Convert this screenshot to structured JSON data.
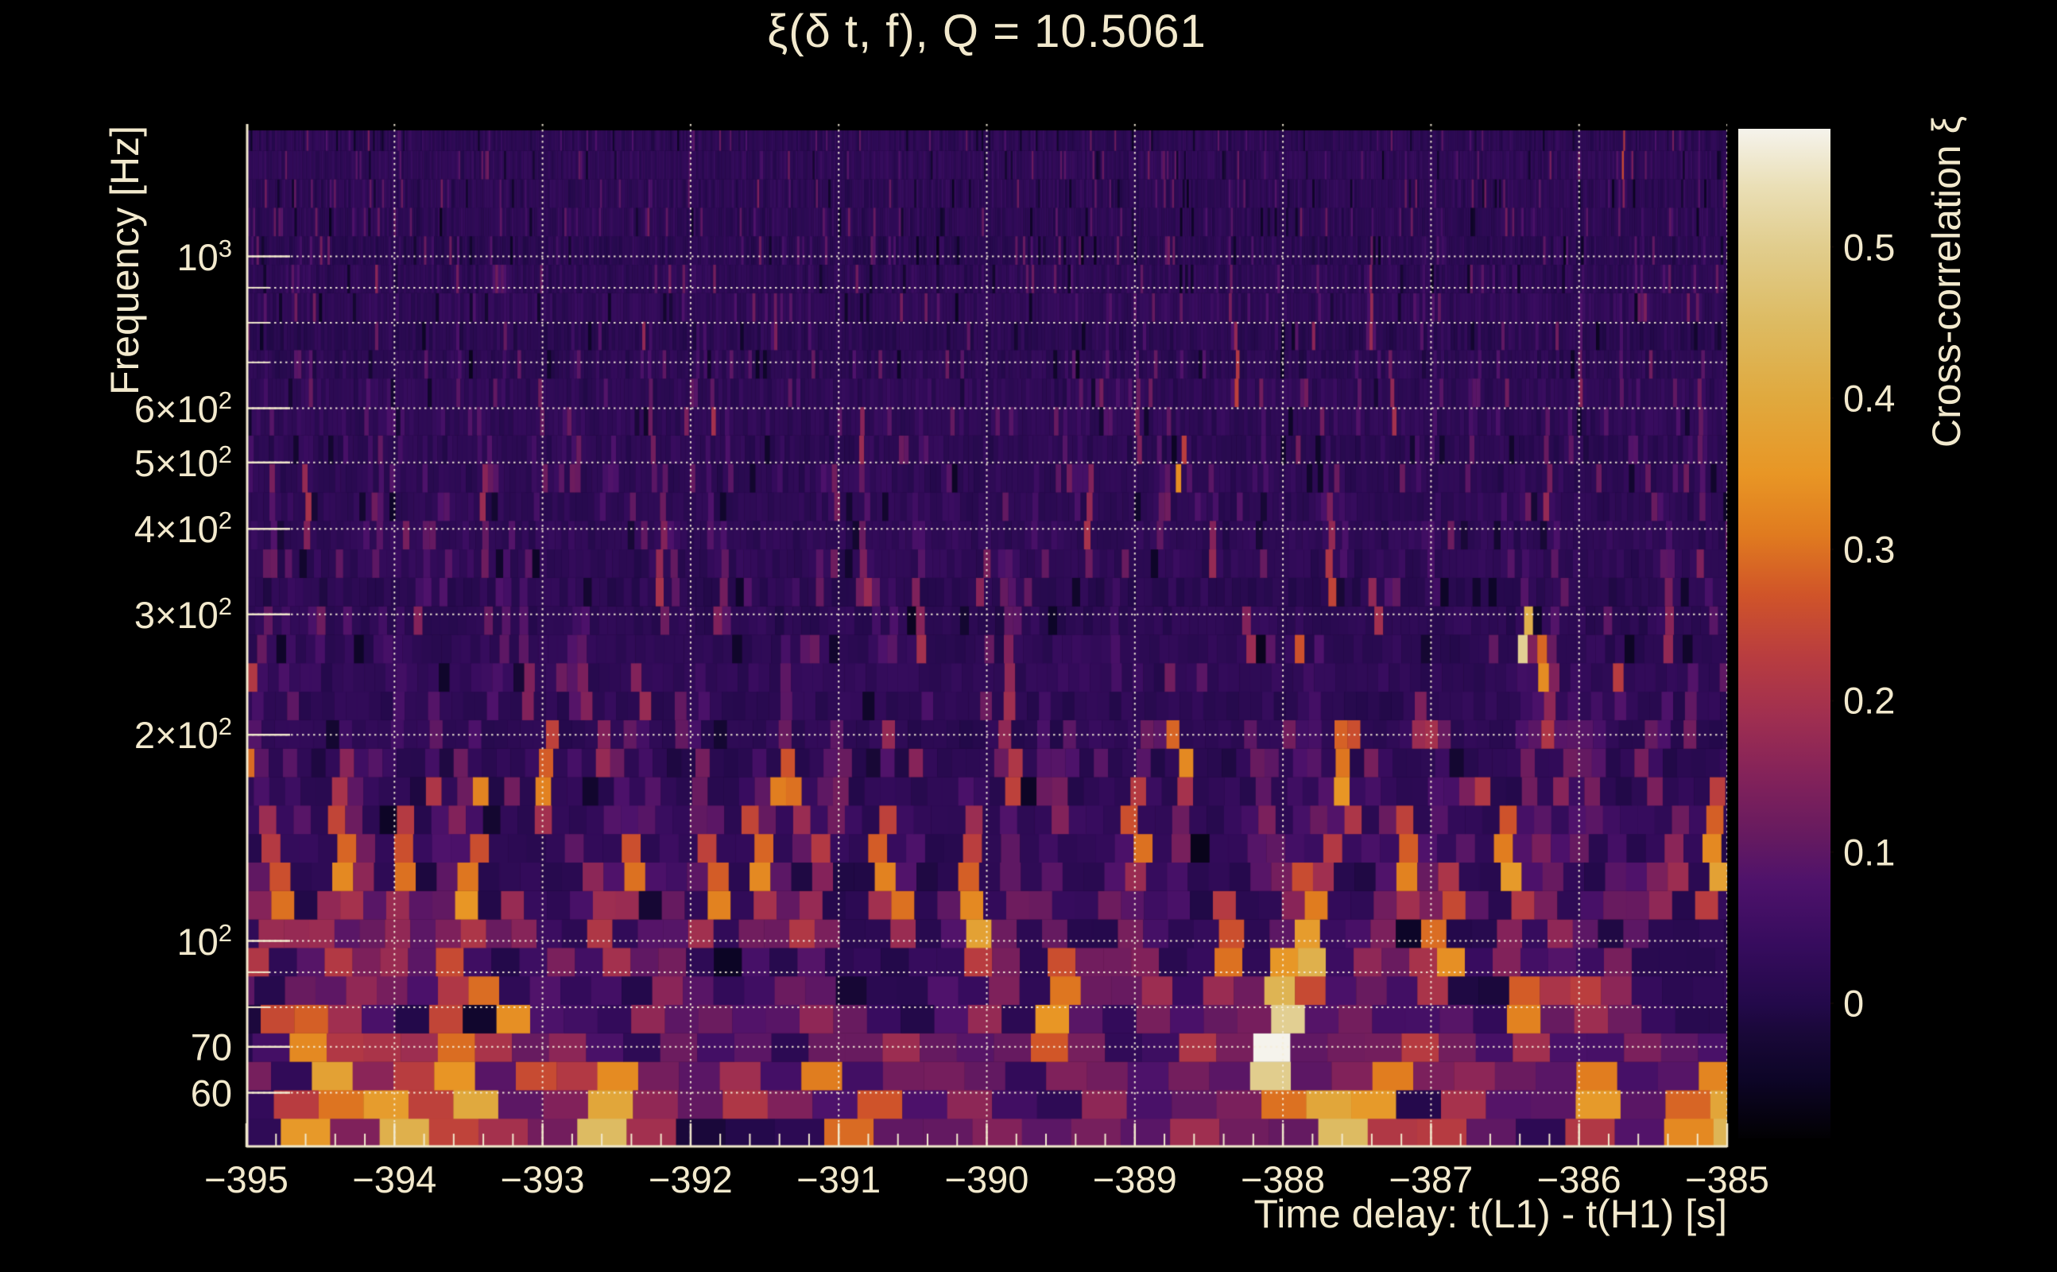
{
  "page": {
    "background": "#000000",
    "text_color": "#f2e9cd"
  },
  "chart_data": {
    "type": "heatmap",
    "title": "ξ(δ t, f), Q = 10.5061",
    "q_value": "10.5061",
    "xlabel": "Time delay: t(L1) - t(H1) [s]",
    "ylabel": "Frequency [Hz]",
    "colorbar_label": "Cross-correlation ξ",
    "x_range": [
      -395,
      -385
    ],
    "x_tick_labels": [
      "−395",
      "−394",
      "−393",
      "−392",
      "−391",
      "−390",
      "−389",
      "−388",
      "−387",
      "−386",
      "−385"
    ],
    "x_tick_values": [
      -395,
      -394,
      -393,
      -392,
      -391,
      -390,
      -389,
      -388,
      -387,
      -386,
      -385
    ],
    "x_minor_step": 0.2,
    "y_scale": "log",
    "y_range": [
      50,
      1560
    ],
    "y_tick_labels": [
      {
        "main": "10",
        "sup": "3",
        "f": 1000
      },
      {
        "main": "6×10",
        "sup": "2",
        "f": 600
      },
      {
        "main": "5×10",
        "sup": "2",
        "f": 500
      },
      {
        "main": "4×10",
        "sup": "2",
        "f": 400
      },
      {
        "main": "3×10",
        "sup": "2",
        "f": 300
      },
      {
        "main": "2×10",
        "sup": "2",
        "f": 200
      },
      {
        "main": "10",
        "sup": "2",
        "f": 100
      },
      {
        "main": "70",
        "sup": "",
        "f": 70
      },
      {
        "main": "60",
        "sup": "",
        "f": 60
      }
    ],
    "y_minor_ticks": [
      900,
      800,
      700,
      90,
      80
    ],
    "y_gridlines": [
      1000,
      900,
      800,
      700,
      600,
      500,
      400,
      300,
      200,
      100,
      90,
      80,
      70,
      60
    ],
    "grid": "dotted",
    "legend_position": "right-colorbar",
    "colorbar": {
      "min": -0.089,
      "max": 0.578,
      "tick_values": [
        0.5,
        0.4,
        0.3,
        0.2,
        0.1,
        0
      ],
      "tick_labels": [
        "0.5",
        "0.4",
        "0.3",
        "0.2",
        "0.1",
        "0"
      ],
      "stops": [
        {
          "v": -0.089,
          "c": "#020103"
        },
        {
          "v": -0.05,
          "c": "#0d0527"
        },
        {
          "v": -0.02,
          "c": "#190838"
        },
        {
          "v": 0.0,
          "c": "#23094a"
        },
        {
          "v": 0.04,
          "c": "#370c5e"
        },
        {
          "v": 0.08,
          "c": "#4e126b"
        },
        {
          "v": 0.11,
          "c": "#651a60"
        },
        {
          "v": 0.15,
          "c": "#83225a"
        },
        {
          "v": 0.19,
          "c": "#a02f50"
        },
        {
          "v": 0.23,
          "c": "#b93d3f"
        },
        {
          "v": 0.27,
          "c": "#d05429"
        },
        {
          "v": 0.31,
          "c": "#e07b1f"
        },
        {
          "v": 0.35,
          "c": "#e89625"
        },
        {
          "v": 0.4,
          "c": "#e0a93e"
        },
        {
          "v": 0.45,
          "c": "#ddbb62"
        },
        {
          "v": 0.5,
          "c": "#e1cd8d"
        },
        {
          "v": 0.54,
          "c": "#eadfb6"
        },
        {
          "v": 0.578,
          "c": "#f5f3ec"
        }
      ]
    },
    "heatmap": {
      "f0": 50,
      "rows": 36,
      "row_ratio": 1.1005,
      "tile_duration_factor": 17.5,
      "seed": 1337,
      "noise_events": 540,
      "hotspots": [
        [
          -394.83,
          110,
          0.3,
          4
        ],
        [
          -394.55,
          62,
          0.38,
          3
        ],
        [
          -394.35,
          120,
          0.33,
          5
        ],
        [
          -394.0,
          52,
          0.42,
          2
        ],
        [
          -393.96,
          130,
          0.3,
          3
        ],
        [
          -393.55,
          58,
          0.4,
          4
        ],
        [
          -393.48,
          110,
          0.35,
          3
        ],
        [
          -393.3,
          80,
          0.34,
          2
        ],
        [
          -392.95,
          160,
          0.32,
          3
        ],
        [
          -392.55,
          55,
          0.45,
          3
        ],
        [
          -392.4,
          120,
          0.3,
          2
        ],
        [
          -392.2,
          320,
          0.2,
          3
        ],
        [
          -391.85,
          110,
          0.32,
          3
        ],
        [
          -391.55,
          120,
          0.33,
          3
        ],
        [
          -391.3,
          170,
          0.3,
          2
        ],
        [
          -390.85,
          500,
          0.18,
          2
        ],
        [
          -390.7,
          130,
          0.32,
          3
        ],
        [
          -390.62,
          110,
          0.3,
          2
        ],
        [
          -390.1,
          100,
          0.38,
          5
        ],
        [
          -389.55,
          75,
          0.35,
          3
        ],
        [
          -389.3,
          400,
          0.2,
          3
        ],
        [
          -389.0,
          140,
          0.3,
          3
        ],
        [
          -388.7,
          180,
          0.33,
          2
        ],
        [
          -388.35,
          95,
          0.3,
          3
        ],
        [
          -388.05,
          65,
          0.5,
          3
        ],
        [
          -387.95,
          70,
          0.58,
          4
        ],
        [
          -387.85,
          95,
          0.42,
          4
        ],
        [
          -387.75,
          55,
          0.45,
          2
        ],
        [
          -387.55,
          160,
          0.35,
          3
        ],
        [
          -387.3,
          60,
          0.36,
          2
        ],
        [
          -387.15,
          120,
          0.32,
          3
        ],
        [
          -386.9,
          90,
          0.34,
          4
        ],
        [
          -386.45,
          120,
          0.36,
          3
        ],
        [
          -386.3,
          75,
          0.32,
          2
        ],
        [
          -386.0,
          58,
          0.36,
          2
        ],
        [
          -385.7,
          1300,
          0.25,
          3
        ],
        [
          -385.4,
          52,
          0.33,
          2
        ],
        [
          -385.1,
          130,
          0.38,
          4
        ],
        [
          -393.4,
          450,
          0.18,
          2
        ],
        [
          -394.6,
          420,
          0.2,
          2
        ]
      ]
    },
    "axis_color": "#f2e9cd",
    "gridline_color": "#f5eed9"
  }
}
